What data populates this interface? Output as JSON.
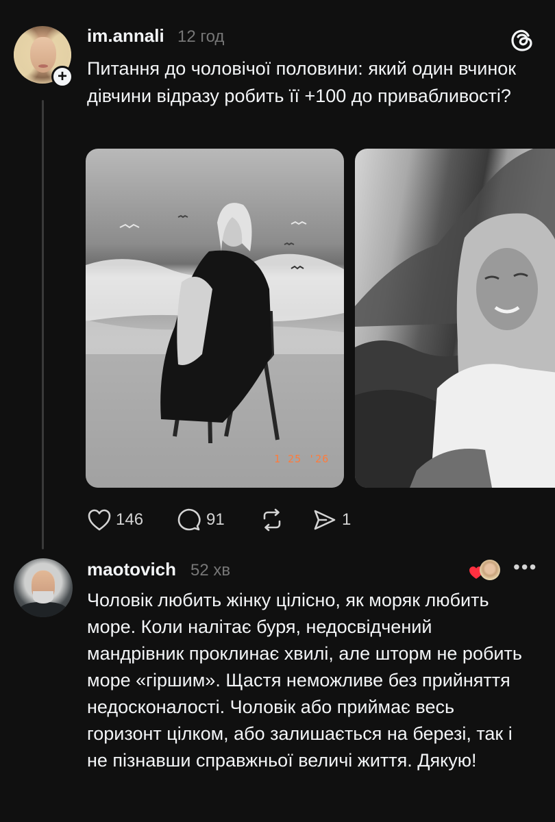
{
  "post": {
    "username": "im.annali",
    "time": "12 год",
    "follow_icon": "plus-icon",
    "text": "Питання до чоловічої половини: який один вчинок дівчини відразу робить її +100 до привабливості?",
    "photos": [
      {
        "caption_stamp": "1 25 '26"
      },
      {}
    ],
    "stats": {
      "likes": "146",
      "comments": "91",
      "shares": "1"
    },
    "icons": [
      "heart-icon",
      "comment-icon",
      "repost-icon",
      "share-icon",
      "threads-logo-icon"
    ]
  },
  "reply": {
    "username": "maotovich",
    "time": "52 хв",
    "text": "Чоловік любить жінку цілісно, як моряк любить море. Коли налітає буря, недосвідчений мандрівник проклинає хвилі, але шторм не робить море «гіршим». Щастя неможливе без прийняття недосконалості. Чоловік або приймає весь горизонт цілком, або залишається на березі, так і не пізнавши справжньої величі життя. Дякую!",
    "more_label": "•••",
    "icons": [
      "liked-by-author-heart-icon",
      "more-options-icon"
    ]
  },
  "colors": {
    "background": "#101010",
    "text": "#f3f5f7",
    "secondary": "#777777",
    "like_heart": "#ff3040"
  }
}
